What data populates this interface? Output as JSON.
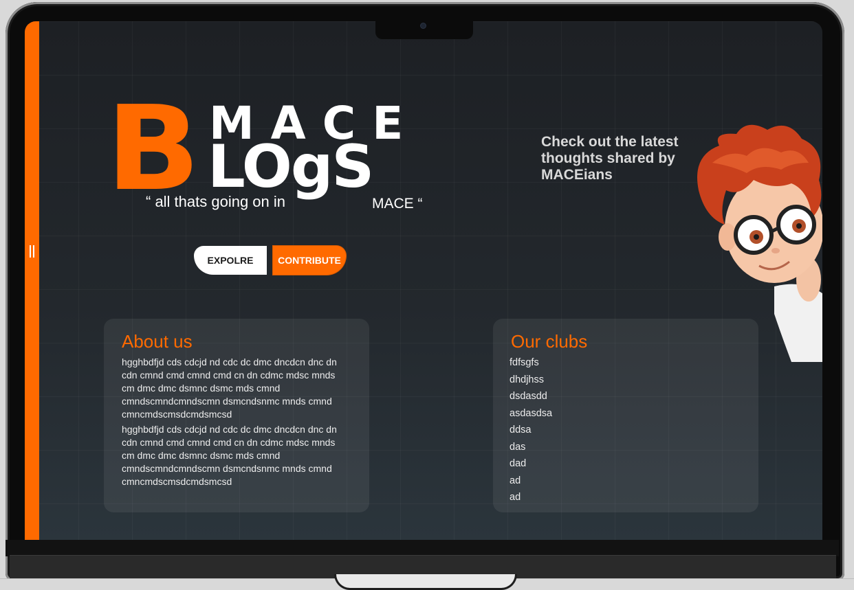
{
  "logo": {
    "big_letter": "B",
    "top_word": "MACE",
    "bottom_word": "LOgS"
  },
  "tagline": {
    "part1": "“ all thats going on in",
    "part2": "MACE “"
  },
  "buttons": {
    "explore": "EXPOLRE",
    "contribute": "CONTRIBUTE"
  },
  "hero": {
    "text": "Check out the latest thoughts shared by MACEians"
  },
  "about": {
    "title": "About us",
    "paragraphs": [
      "hgghbdfjd cds cdcjd nd cdc dc dmc dncdcn dnc dn cdn cmnd cmd cmnd cmd cn dn cdmc mdsc mnds cm dmc dmc dsmnc dsmc mds cmnd cmndscmndcmndscmn  dsmcndsnmc mnds cmnd cmncmdscmsdcmdsmcsd",
      "hgghbdfjd cds cdcjd nd cdc dc dmc dncdcn dnc dn cdn cmnd cmd cmnd cmd cn dn cdmc mdsc mnds cm dmc dmc dsmnc dsmc mds cmnd cmndscmndcmndscmn  dsmcndsnmc mnds cmnd cmncmdscmsdcmdsmcsd"
    ]
  },
  "clubs": {
    "title": "Our clubs",
    "items": [
      "fdfsgfs",
      "dhdjhss",
      "dsdasdd",
      "asdasdsa",
      "ddsa",
      "das",
      "dad",
      "ad",
      "ad"
    ]
  },
  "icons": {
    "sidebar_handle": "pause-handle-icon",
    "mascot": "cartoon-boy-mascot"
  },
  "colors": {
    "accent": "#ff6a00",
    "background": "#1f2327",
    "card": "#33393f",
    "text": "#ededed"
  }
}
